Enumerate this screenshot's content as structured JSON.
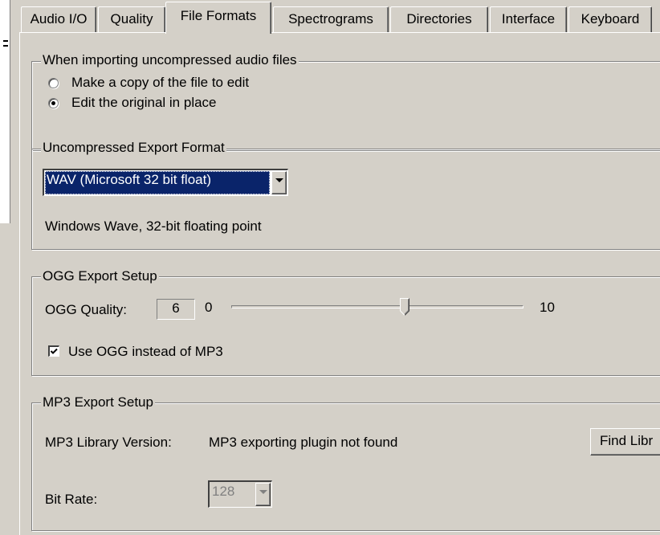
{
  "tabs": [
    {
      "label": "Audio I/O"
    },
    {
      "label": "Quality"
    },
    {
      "label": "File Formats",
      "selected": true
    },
    {
      "label": "Spectrograms"
    },
    {
      "label": "Directories"
    },
    {
      "label": "Interface"
    },
    {
      "label": "Keyboard"
    }
  ],
  "import_group": {
    "title": "When importing uncompressed audio files",
    "options": [
      {
        "label": "Make a copy of the file to edit",
        "selected": false
      },
      {
        "label": "Edit the original in place",
        "selected": true
      }
    ]
  },
  "export_format_group": {
    "title": "Uncompressed Export Format",
    "selected_format": "WAV (Microsoft 32 bit float)",
    "description": "Windows Wave, 32-bit floating point"
  },
  "ogg_group": {
    "title": "OGG Export Setup",
    "quality_label": "OGG Quality:",
    "quality_value": "6",
    "slider_min_label": "0",
    "slider_max_label": "10",
    "slider": {
      "min": 0,
      "max": 10,
      "value": 6
    },
    "use_ogg_label": "Use OGG instead of MP3",
    "use_ogg_checked": true
  },
  "mp3_group": {
    "title": "MP3 Export Setup",
    "library_version_label": "MP3 Library Version:",
    "library_version_value": "MP3 exporting plugin not found",
    "find_library_button": "Find Libr",
    "bit_rate_label": "Bit Rate:",
    "bit_rate_value": "128"
  },
  "colors": {
    "face": "#d4d0c8",
    "highlight": "#0a246a",
    "shadow": "#808080"
  }
}
